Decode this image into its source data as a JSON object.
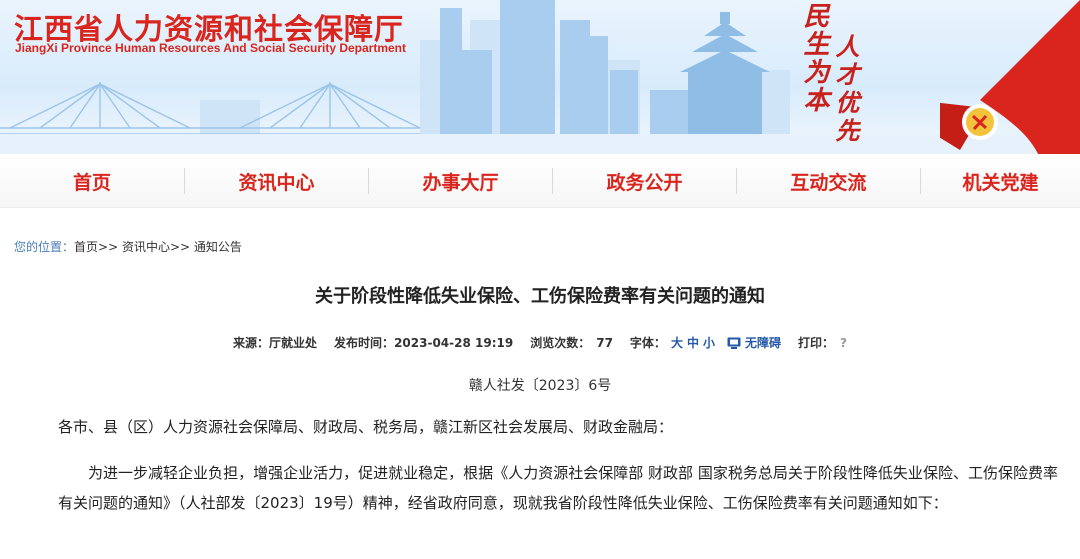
{
  "header": {
    "title": "江西省人力资源和社会保障厅",
    "subtitle": "JiangXi Province Human Resources And Social Security Department",
    "slogan_left": "民生为本",
    "slogan_right": "人才优先"
  },
  "nav": {
    "items": [
      {
        "label": "首页"
      },
      {
        "label": "资讯中心"
      },
      {
        "label": "办事大厅"
      },
      {
        "label": "政务公开"
      },
      {
        "label": "互动交流"
      },
      {
        "label": "机关党建"
      }
    ]
  },
  "breadcrumb": {
    "prefix": "您的位置：",
    "items": [
      "首页>>",
      "资讯中心>>",
      "通知公告"
    ]
  },
  "article": {
    "title": "关于阶段性降低失业保险、工伤保险费率有关问题的通知",
    "meta": {
      "source_label": "来源：",
      "source": "厅就业处",
      "date_label": "发布时间：",
      "date": "2023-04-28 19:19",
      "views_label": "浏览次数：",
      "views": "77",
      "font_label": "字体：",
      "font_large": "大",
      "font_medium": "中",
      "font_small": "小",
      "accessibility": "无障碍",
      "print_label": "打印：",
      "print_icon": "?"
    },
    "doc_number": "赣人社发〔2023〕6号",
    "salutation": "各市、县（区）人力资源社会保障局、财政局、税务局，赣江新区社会发展局、财政金融局：",
    "paragraph": "为进一步减轻企业负担，增强企业活力，促进就业稳定，根据《人力资源社会保障部 财政部 国家税务总局关于阶段性降低失业保险、工伤保险费率有关问题的通知》（人社部发〔2023〕19号）精神，经省政府同意，现就我省阶段性降低失业保险、工伤保险费率有关问题通知如下："
  },
  "colors": {
    "brand_red": "#d9251d",
    "link_blue": "#2559a8",
    "sky": "#d8ebfb"
  }
}
